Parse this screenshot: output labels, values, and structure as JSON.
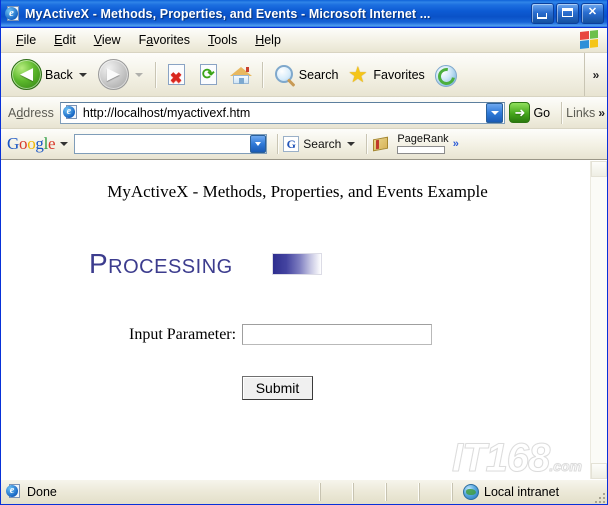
{
  "window": {
    "title": "MyActiveX - Methods, Properties, and Events - Microsoft Internet ...",
    "app_icon": "ie-document-icon",
    "buttons": {
      "minimize": "minimize-button",
      "maximize": "maximize-button",
      "close": "close-button",
      "close_glyph": "✕"
    }
  },
  "menubar": {
    "items": [
      {
        "label": "File",
        "accel": "F"
      },
      {
        "label": "Edit",
        "accel": "E"
      },
      {
        "label": "View",
        "accel": "V"
      },
      {
        "label": "Favorites",
        "accel": "a"
      },
      {
        "label": "Tools",
        "accel": "T"
      },
      {
        "label": "Help",
        "accel": "H"
      }
    ],
    "brand_icon": "windows-flag-icon"
  },
  "toolbar": {
    "back_label": "Back",
    "back_icon": "back-arrow-icon",
    "back_glyph": "◀",
    "forward_icon": "forward-arrow-icon",
    "forward_glyph": "▶",
    "stop_icon": "stop-icon",
    "stop_glyph": "✖",
    "refresh_icon": "refresh-icon",
    "refresh_glyph": "⟳",
    "home_icon": "home-icon",
    "search_label": "Search",
    "search_icon": "search-magnifier-icon",
    "favorites_label": "Favorites",
    "favorites_icon": "star-icon",
    "favorites_glyph": "★",
    "media_icon": "media-icon",
    "overflow_glyph": "»"
  },
  "address": {
    "label": "Address",
    "label_accel": "d",
    "url": "http://localhost/myactivexf.htm",
    "page_icon": "ie-page-icon",
    "dropdown_icon": "chevron-down-icon",
    "go_label": "Go",
    "go_icon": "go-arrow-icon",
    "go_glyph": "➜",
    "links_label": "Links",
    "links_overflow_glyph": "»"
  },
  "google_toolbar": {
    "logo": {
      "g1": "G",
      "o1": "o",
      "o2": "o",
      "g2": "g",
      "l": "l",
      "e": "e"
    },
    "logo_caret": "chevron-down-icon",
    "search_value": "",
    "search_placeholder": "",
    "search_dropdown_icon": "chevron-down-icon",
    "search_button_label": "Search",
    "search_button_icon": "google-g-icon",
    "search_button_letter": "G",
    "search_caret": "chevron-down-icon",
    "pagerank_label": "PageRank",
    "pagerank_icon": "pagerank-book-icon",
    "pagerank_value": "",
    "overflow_glyph": "»"
  },
  "page": {
    "heading": "MyActiveX - Methods, Properties, and Events Example",
    "status_text": "Processing",
    "progress_bar": {
      "name": "processing-progress-bar",
      "gradient_from": "#2e2e8f",
      "gradient_to": "#ffffff"
    },
    "form": {
      "input_label": "Input Parameter:",
      "input_value": "",
      "input_placeholder": "",
      "submit_label": "Submit"
    },
    "watermark": {
      "text": "IT168",
      "suffix": ".com"
    },
    "text_color_accent": "#3c3c8e"
  },
  "statusbar": {
    "message": "Done",
    "message_icon": "ie-page-icon",
    "zone": "Local intranet",
    "zone_icon": "globe-icon",
    "resize_grip": "resize-grip"
  }
}
